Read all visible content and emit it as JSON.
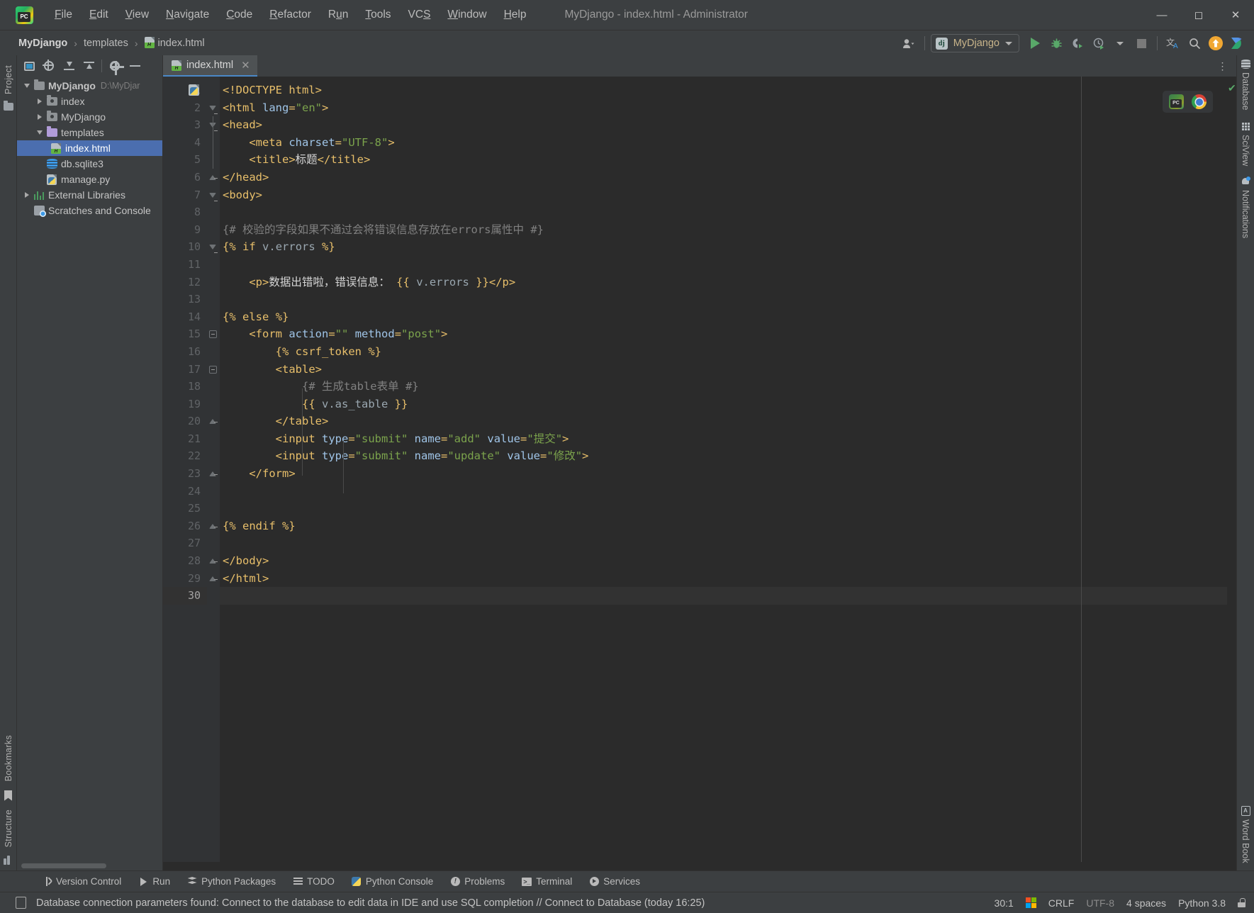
{
  "window": {
    "title": "MyDjango - index.html - Administrator",
    "app_icon": "pycharm-logo-icon",
    "controls": {
      "minimize": "—",
      "maximize": "☐",
      "close": "✕"
    }
  },
  "menubar": {
    "items": [
      {
        "label": "File",
        "mnemonic": "F"
      },
      {
        "label": "Edit",
        "mnemonic": "E"
      },
      {
        "label": "View",
        "mnemonic": "V"
      },
      {
        "label": "Navigate",
        "mnemonic": "N"
      },
      {
        "label": "Code",
        "mnemonic": "C"
      },
      {
        "label": "Refactor",
        "mnemonic": "R"
      },
      {
        "label": "Run",
        "mnemonic": "u"
      },
      {
        "label": "Tools",
        "mnemonic": "T"
      },
      {
        "label": "VCS",
        "mnemonic": "S"
      },
      {
        "label": "Window",
        "mnemonic": "W"
      },
      {
        "label": "Help",
        "mnemonic": "H"
      }
    ]
  },
  "navbar": {
    "breadcrumbs": [
      {
        "label": "MyDjango",
        "bold": true,
        "icon": ""
      },
      {
        "label": "templates",
        "bold": false,
        "icon": ""
      },
      {
        "label": "index.html",
        "bold": false,
        "icon": "html-file-icon"
      }
    ],
    "separator": "›"
  },
  "toolbar": {
    "user_icon": "user-account-icon",
    "run_config": {
      "icon": "django-icon",
      "icon_text": "dj",
      "name": "MyDjango"
    },
    "buttons": [
      {
        "name": "run-button",
        "icon": "run-play-icon"
      },
      {
        "name": "debug-button",
        "icon": "bug-icon"
      },
      {
        "name": "run-with-coverage-button",
        "icon": "coverage-icon"
      },
      {
        "name": "profile-button",
        "icon": "profiler-clock-icon"
      },
      {
        "name": "stop-button",
        "icon": "stop-square-icon"
      },
      {
        "name": "translate-button",
        "icon": "translate-icon",
        "glyph": "文"
      },
      {
        "name": "search-everywhere-button",
        "icon": "search-icon"
      },
      {
        "name": "update-project-button",
        "icon": "update-arrow-up-icon"
      },
      {
        "name": "ide-assistant-button",
        "icon": "plugin-diamond-icon"
      }
    ]
  },
  "left_rail": {
    "top_label": "Project",
    "bottom_labels": [
      "Bookmarks",
      "Structure"
    ]
  },
  "project_panel": {
    "toolbar_buttons": [
      {
        "name": "select-opened-file-button",
        "icon": "select-target-icon"
      },
      {
        "name": "locate-button",
        "icon": "crosshair-icon"
      },
      {
        "name": "expand-all-button",
        "icon": "expand-all-icon"
      },
      {
        "name": "collapse-all-button",
        "icon": "collapse-all-icon"
      },
      {
        "name": "settings-button",
        "icon": "gear-icon"
      },
      {
        "name": "hide-button",
        "icon": "minus-icon"
      }
    ],
    "tree": [
      {
        "label": "MyDjango",
        "path": "D:\\MyDjar",
        "icon": "folder-gray-icon",
        "indent": 0,
        "twisty": "open",
        "bold": true,
        "selected": false
      },
      {
        "label": "index",
        "path": "",
        "icon": "folder-module-icon",
        "indent": 1,
        "twisty": "closed",
        "bold": false,
        "selected": false
      },
      {
        "label": "MyDjango",
        "path": "",
        "icon": "folder-module-icon",
        "indent": 1,
        "twisty": "closed",
        "bold": false,
        "selected": false
      },
      {
        "label": "templates",
        "path": "",
        "icon": "folder-templates-icon",
        "indent": 1,
        "twisty": "open",
        "bold": false,
        "selected": false
      },
      {
        "label": "index.html",
        "path": "",
        "icon": "html-file-icon",
        "indent": 2,
        "twisty": "none",
        "bold": false,
        "selected": true
      },
      {
        "label": "db.sqlite3",
        "path": "",
        "icon": "database-file-icon",
        "indent": 1,
        "twisty": "none",
        "bold": false,
        "selected": false
      },
      {
        "label": "manage.py",
        "path": "",
        "icon": "python-file-icon",
        "indent": 1,
        "twisty": "none",
        "bold": false,
        "selected": false
      },
      {
        "label": "External Libraries",
        "path": "",
        "icon": "libraries-icon",
        "indent": 0,
        "twisty": "closed",
        "bold": false,
        "selected": false
      },
      {
        "label": "Scratches and Console",
        "path": "",
        "icon": "scratches-icon",
        "indent": 0,
        "twisty": "none",
        "bold": false,
        "selected": false
      }
    ]
  },
  "editor": {
    "tab": {
      "label": "index.html",
      "icon": "html-file-icon",
      "close": "✕"
    },
    "more_tabs_icon": "vertical-dots-icon",
    "inspection_status": "✔",
    "preview_icons": [
      {
        "name": "preview-in-pycharm-icon"
      },
      {
        "name": "preview-in-chrome-icon"
      }
    ],
    "caret_line": 30,
    "total_lines": 30,
    "lines": [
      {
        "n": 1,
        "text": "<!DOCTYPE html>"
      },
      {
        "n": 2,
        "text": "<html lang=\"en\">"
      },
      {
        "n": 3,
        "text": "<head>"
      },
      {
        "n": 4,
        "text": "    <meta charset=\"UTF-8\">"
      },
      {
        "n": 5,
        "text": "    <title>标题</title>"
      },
      {
        "n": 6,
        "text": "</head>"
      },
      {
        "n": 7,
        "text": "<body>"
      },
      {
        "n": 8,
        "text": ""
      },
      {
        "n": 9,
        "text": "{# 校验的字段如果不通过会将错误信息存放在errors属性中 #}"
      },
      {
        "n": 10,
        "text": "{% if v.errors %}"
      },
      {
        "n": 11,
        "text": ""
      },
      {
        "n": 12,
        "text": "    <p>数据出错啦，错误信息： {{ v.errors }}</p>"
      },
      {
        "n": 13,
        "text": ""
      },
      {
        "n": 14,
        "text": "{% else %}"
      },
      {
        "n": 15,
        "text": "    <form action=\"\" method=\"post\">"
      },
      {
        "n": 16,
        "text": "        {% csrf_token %}"
      },
      {
        "n": 17,
        "text": "        <table>"
      },
      {
        "n": 18,
        "text": "            {# 生成table表单 #}"
      },
      {
        "n": 19,
        "text": "            {{ v.as_table }}"
      },
      {
        "n": 20,
        "text": "        </table>"
      },
      {
        "n": 21,
        "text": "        <input type=\"submit\" name=\"add\" value=\"提交\">"
      },
      {
        "n": 22,
        "text": "        <input type=\"submit\" name=\"update\" value=\"修改\">"
      },
      {
        "n": 23,
        "text": "    </form>"
      },
      {
        "n": 24,
        "text": ""
      },
      {
        "n": 25,
        "text": ""
      },
      {
        "n": 26,
        "text": "{% endif %}"
      },
      {
        "n": 27,
        "text": ""
      },
      {
        "n": 28,
        "text": "</body>"
      },
      {
        "n": 29,
        "text": "</html>"
      },
      {
        "n": 30,
        "text": ""
      }
    ]
  },
  "right_rail": {
    "items": [
      {
        "label": "Database",
        "icon": "database-icon"
      },
      {
        "label": "SciView",
        "icon": "sciview-grid-icon"
      },
      {
        "label": "Notifications",
        "icon": "bell-icon"
      }
    ],
    "bottom": {
      "label": "Word Book",
      "icon": "word-book-icon"
    }
  },
  "tool_windows": [
    {
      "label": "Version Control",
      "icon": "branch-icon"
    },
    {
      "label": "Run",
      "icon": "run-play-icon"
    },
    {
      "label": "Python Packages",
      "icon": "packages-icon"
    },
    {
      "label": "TODO",
      "icon": "todo-list-icon"
    },
    {
      "label": "Python Console",
      "icon": "python-icon"
    },
    {
      "label": "Problems",
      "icon": "problems-icon"
    },
    {
      "label": "Terminal",
      "icon": "terminal-icon"
    },
    {
      "label": "Services",
      "icon": "services-icon"
    }
  ],
  "statusbar": {
    "icon": "notification-document-icon",
    "message": "Database connection parameters found: Connect to the database to edit data in IDE and use SQL completion // Connect to Database (today 16:25)",
    "caret_position": "30:1",
    "os_icon": "windows-logo-icon",
    "line_separator": "CRLF",
    "encoding": "UTF-8",
    "indent": "4 spaces",
    "interpreter": "Python 3.8",
    "lock_icon": "lock-icon"
  },
  "colors": {
    "accent_blue": "#4b6eaf",
    "tab_underline": "#4a88c7",
    "run_green": "#59a869",
    "tag_orange": "#e8bf6a",
    "string_green": "#7ba34c",
    "attr_blue": "#a0c5e8",
    "comment_gray": "#808080",
    "editor_bg": "#2b2b2b",
    "panel_bg": "#3c3f41",
    "update_orange": "#f0a732"
  }
}
